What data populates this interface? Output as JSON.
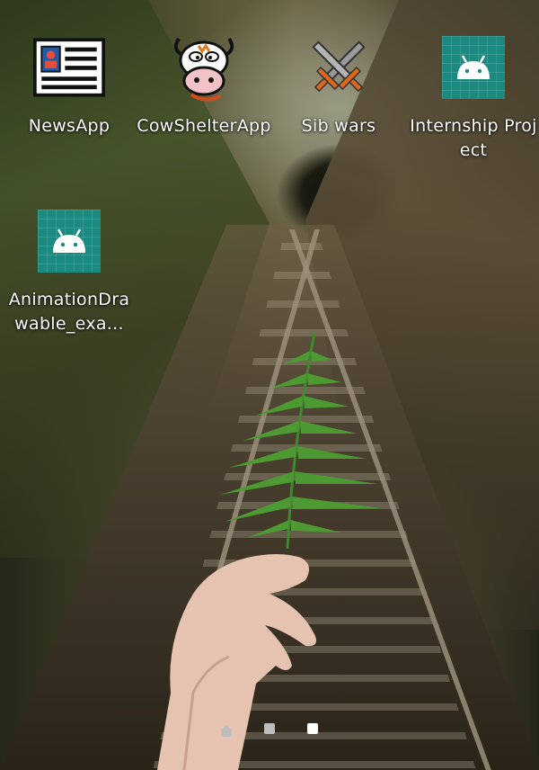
{
  "home_screen": {
    "apps": [
      {
        "label": "NewsApp",
        "icon": "newspaper-icon"
      },
      {
        "label": "CowShelterApp",
        "icon": "cow-icon"
      },
      {
        "label": "Sib wars",
        "icon": "crossed-swords-icon"
      },
      {
        "label": "Internship Project",
        "icon": "android-icon"
      },
      {
        "label": "AnimationDrawable_exa...",
        "icon": "android-icon"
      }
    ],
    "page_indicator": {
      "pages": 3,
      "current_page": 3,
      "first_page_icon": "home-icon"
    },
    "colors": {
      "android_tile": "#1b8a80",
      "label_text": "#ffffff"
    }
  }
}
